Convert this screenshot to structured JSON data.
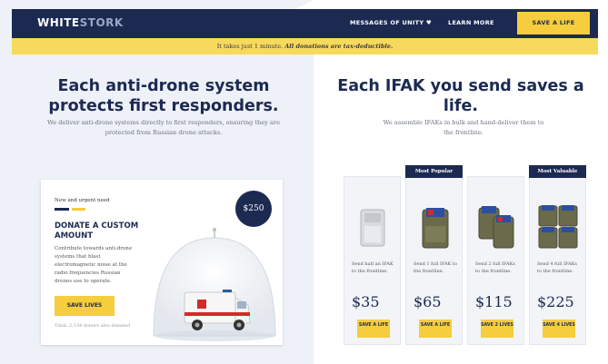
{
  "header": {
    "logo_main": "WHITE",
    "logo_faded": "STORK",
    "nav_messages": "MESSAGES OF UNITY ♥",
    "nav_learn": "LEARN MORE",
    "cta": "SAVE A LIFE"
  },
  "banner": {
    "text": "It takes just 1 minute. ",
    "bold": "All donations are tax-deductible."
  },
  "left": {
    "heading": "Each anti-drone system protects first responders.",
    "subtext": "We deliver anti-drone systems directly to first responders, ensuring they are protected from Russian drone attacks."
  },
  "right": {
    "heading": "Each IFAK you send saves a life.",
    "subtext": "We assemble IFAKs in bulk and hand-deliver them to the frontline."
  },
  "donate_card": {
    "small": "New and urgent need",
    "title": "DONATE A CUSTOM AMOUNT",
    "description": "Contribute towards anti-drone systems that blast electromagnetic noise at the radio frequencies Russian drones use to operate.",
    "button": "SAVE LIVES",
    "footer": "Total: 2,134 donors also donated",
    "badge": "$250"
  },
  "ifaks": [
    {
      "tag": "",
      "text": "Send half an IFAK to the frontline.",
      "price": "$35",
      "button": "SAVE A LIFE"
    },
    {
      "tag": "Most Popular",
      "text": "Send 1 full IFAK to the frontline.",
      "price": "$65",
      "button": "SAVE A LIFE"
    },
    {
      "tag": "",
      "text": "Send 2 full IFAKs to the frontline.",
      "price": "$115",
      "button": "SAVE 2 LIVES"
    },
    {
      "tag": "Most Valuable",
      "text": "Send 4 full IFAKs to the frontline.",
      "price": "$225",
      "button": "SAVE 4 LIVES"
    }
  ],
  "colors": {
    "navy": "#1c2a52",
    "yellow": "#f5cd3d",
    "banner_yellow": "#f7d95c",
    "pale": "#eef1f7"
  }
}
